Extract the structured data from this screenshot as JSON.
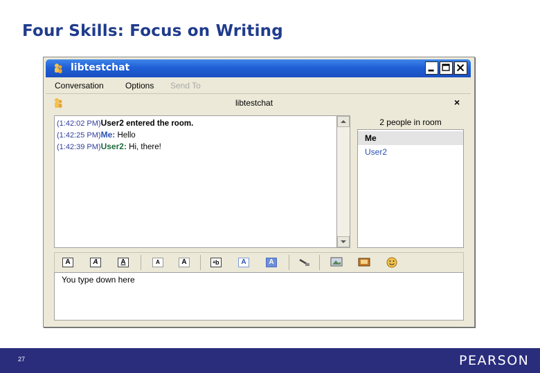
{
  "slide": {
    "title": "Four Skills: Focus on Writing",
    "page_number": "27",
    "brand": "PEARSON"
  },
  "window": {
    "title": "libtestchat",
    "menu": [
      "Conversation",
      "Options",
      "Send To"
    ],
    "tab_label": "libtestchat",
    "tab_close": "×",
    "chat_log": [
      {
        "time": "(1:42:02 PM)",
        "sender": "User2",
        "text": " entered the room.",
        "system": true
      },
      {
        "time": "(1:42:25 PM)",
        "sender": "Me:",
        "text": " Hello",
        "system": false
      },
      {
        "time": "(1:42:39 PM)",
        "sender": "User2:",
        "text": " Hi, there!",
        "system": false
      }
    ],
    "people_header": "2 people in room",
    "people": [
      "Me",
      "User2"
    ],
    "input_text": "You type down here",
    "toolbar_icons": [
      "bold-icon",
      "italic-icon",
      "underline-icon",
      "decrease-font-icon",
      "increase-font-icon",
      "background-color-icon",
      "text-color-icon",
      "highlight-color-icon",
      "link-icon",
      "image-icon",
      "insert-icon",
      "smiley-icon"
    ]
  },
  "colors": {
    "title": "#1f3b8c",
    "footer": "#2a2d7c",
    "titlebar": "#1f5fd6",
    "timestamp": "#2f3e9e"
  }
}
